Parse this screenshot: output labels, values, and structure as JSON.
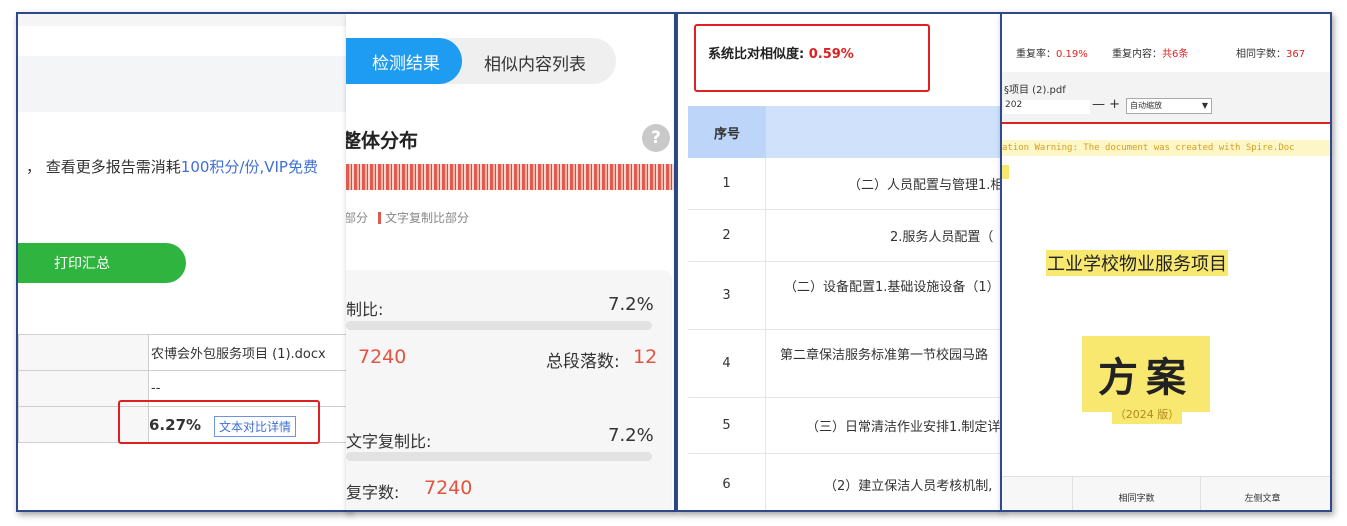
{
  "panel1": {
    "notice_prefix": "， 查看更多报告需消耗",
    "notice_highlight": "100积分/份,VIP免费",
    "print_button": "打印汇总",
    "file_name": "农博会外包服务项目 (1).docx",
    "empty_value": "--",
    "similarity": "6.27%",
    "detail_button": "文本对比详情"
  },
  "panel2": {
    "tab_result": "检测结果",
    "tab_list": "相似内容列表",
    "section_title": "整体分布",
    "help_icon": "?",
    "legend_1": "部分",
    "legend_2": "文字复制比部分",
    "ratio_label_1": "制比:",
    "ratio_value_1": "7.2%",
    "count_1": "7240",
    "paragraphs_label": "总段落数:",
    "paragraphs_value": "12",
    "ratio_label_2": "文字复制比:",
    "ratio_value_2": "7.2%",
    "repeat_label": "复字数:",
    "repeat_value": "7240",
    "progress_1": 0.072,
    "progress_2": 0.072
  },
  "panel3": {
    "similarity_label": "系统比对相似度:",
    "similarity_value": "0.59%",
    "header_index": "序号",
    "rows": [
      {
        "index": "1",
        "text": "（二）人员配置与管理1.相"
      },
      {
        "index": "2",
        "text": "2.服务人员配置（"
      },
      {
        "index": "3",
        "text": "（二）设备配置1.基础设施设备（1）"
      },
      {
        "index": "4",
        "text": "第二章保洁服务标准第一节校园马路"
      },
      {
        "index": "5",
        "text": "（三）日常清洁作业安排1.制定详"
      },
      {
        "index": "6",
        "text": "（2）建立保洁人员考核机制,"
      }
    ]
  },
  "panel4": {
    "repeat_rate_label": "重复率：",
    "repeat_rate_value": "0.19%",
    "repeat_content_label": "重复内容：",
    "repeat_content_value": "共6条",
    "same_words_label": "相同字数：",
    "same_words_value": "367",
    "pdf_name": "§项目 (2).pdf",
    "page_field": "202",
    "zoom_minus": "—",
    "zoom_plus": "+",
    "zoom_select": "自动缩放",
    "warning_text": "ation Warning: The document was created with Spire.Doc",
    "doc_title": "工业学校物业服务项目",
    "doc_big": "方案",
    "doc_year": "（2024 版）",
    "col_same_words": "相同字数",
    "col_left_article": "左侧文章"
  }
}
